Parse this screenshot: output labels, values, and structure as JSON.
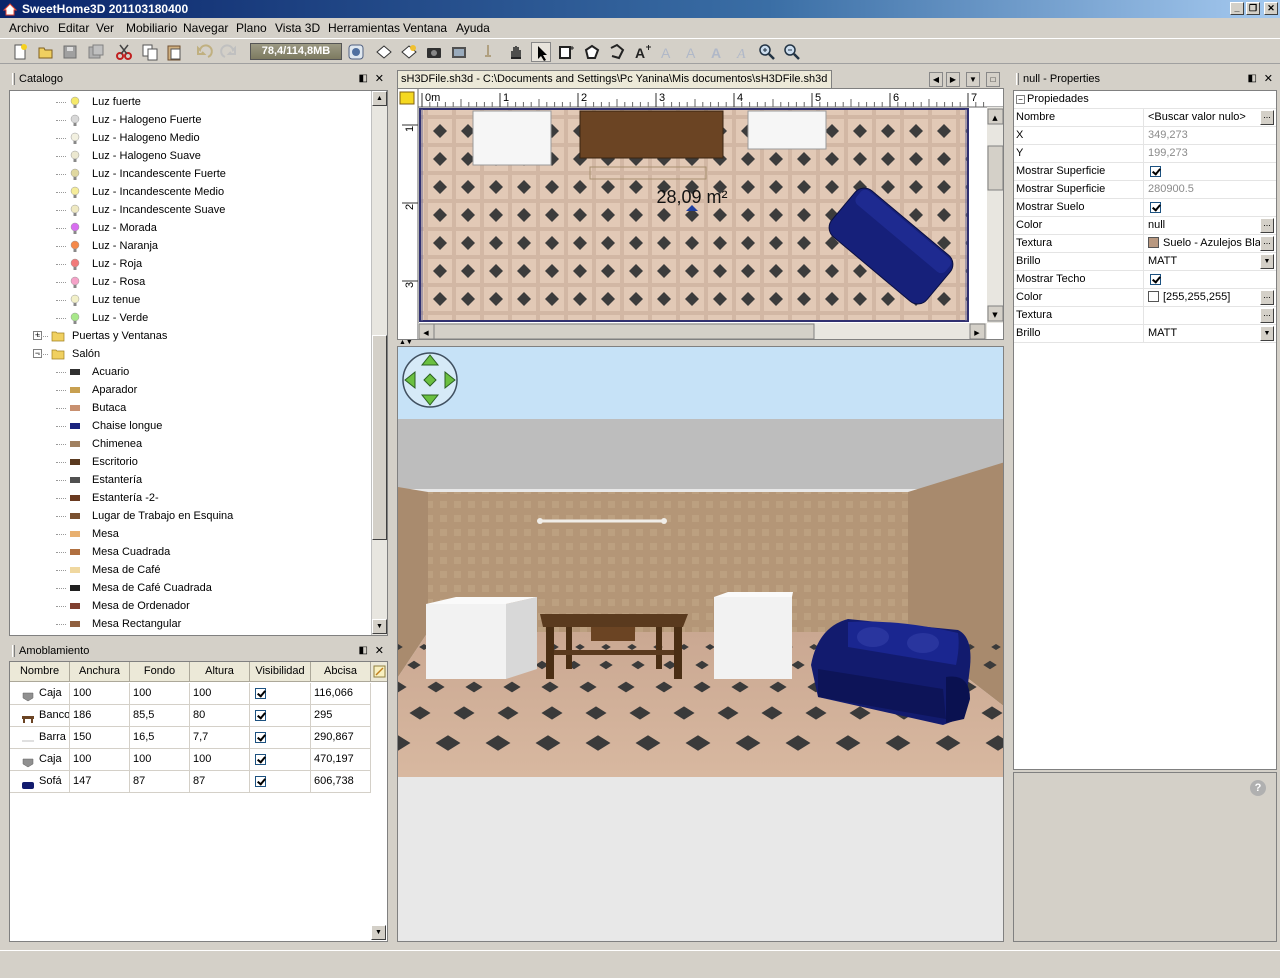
{
  "window": {
    "title": "SweetHome3D 201103180400",
    "minimize_label": "_",
    "maximize_label": "❐",
    "close_label": "✕"
  },
  "menu": [
    "Archivo",
    "Editar",
    "Ver",
    "Mobiliario",
    "Navegar",
    "Plano",
    "Vista 3D",
    "Herramientas",
    "Ventana",
    "Ayuda"
  ],
  "toolbar": {
    "memory": "78,4/114,8MB",
    "icons": [
      "new-icon",
      "open-icon",
      "save-icon",
      "save-as-icon",
      "cut-icon",
      "copy-icon",
      "paste-icon",
      "undo-icon",
      "redo-icon",
      "preferences-icon",
      "add-furniture-icon",
      "import-furniture-icon",
      "photo-icon",
      "video-icon",
      "pan-icon",
      "select-icon",
      "create-walls-icon",
      "create-rooms-icon",
      "create-dimensions-icon",
      "add-text-icon",
      "zoom-in-icon",
      "zoom-out-icon"
    ]
  },
  "catalog": {
    "title": "Catalogo",
    "items": [
      {
        "label": "Luz fuerte",
        "depth": 2,
        "icon": "bulb",
        "color": "#f5e96a"
      },
      {
        "label": "Luz - Halogeno Fuerte",
        "depth": 2,
        "icon": "halogen",
        "color": "#d8d8d8"
      },
      {
        "label": "Luz - Halogeno Medio",
        "depth": 2,
        "icon": "bulb",
        "color": "#f2f0e0"
      },
      {
        "label": "Luz - Halogeno Suave",
        "depth": 2,
        "icon": "bulb",
        "color": "#ece8d0"
      },
      {
        "label": "Luz - Incandescente Fuerte",
        "depth": 2,
        "icon": "halogen",
        "color": "#e0d8a0"
      },
      {
        "label": "Luz - Incandescente Medio",
        "depth": 2,
        "icon": "bulb",
        "color": "#f5ec9a"
      },
      {
        "label": "Luz - Incandescente Suave",
        "depth": 2,
        "icon": "bulb",
        "color": "#efe9c2"
      },
      {
        "label": "Luz - Morada",
        "depth": 2,
        "icon": "bulb",
        "color": "#d86ef0"
      },
      {
        "label": "Luz - Naranja",
        "depth": 2,
        "icon": "bulb",
        "color": "#f5894a"
      },
      {
        "label": "Luz - Roja",
        "depth": 2,
        "icon": "bulb",
        "color": "#f27a7a"
      },
      {
        "label": "Luz - Rosa",
        "depth": 2,
        "icon": "bulb",
        "color": "#f5a2c8"
      },
      {
        "label": "Luz tenue",
        "depth": 2,
        "icon": "bulb",
        "color": "#f2f0c8"
      },
      {
        "label": "Luz - Verde",
        "depth": 2,
        "icon": "bulb",
        "color": "#a8e88a"
      },
      {
        "label": "Puertas y Ventanas",
        "depth": 1,
        "icon": "folder",
        "color": "#f0d060",
        "expander": "+"
      },
      {
        "label": "Salón",
        "depth": 1,
        "icon": "folder-open",
        "color": "#f0d060",
        "expander": "−"
      },
      {
        "label": "Acuario",
        "depth": 2,
        "icon": "aquarium",
        "color": "#303030"
      },
      {
        "label": "Aparador",
        "depth": 2,
        "icon": "sideboard",
        "color": "#c8a050"
      },
      {
        "label": "Butaca",
        "depth": 2,
        "icon": "armchair",
        "color": "#c89070"
      },
      {
        "label": "Chaise longue",
        "depth": 2,
        "icon": "chaise",
        "color": "#1a237e"
      },
      {
        "label": "Chimenea",
        "depth": 2,
        "icon": "fireplace",
        "color": "#a08060"
      },
      {
        "label": "Escritorio",
        "depth": 2,
        "icon": "desk",
        "color": "#5a3a20"
      },
      {
        "label": "Estantería",
        "depth": 2,
        "icon": "shelf",
        "color": "#505050"
      },
      {
        "label": "Estantería -2-",
        "depth": 2,
        "icon": "shelf",
        "color": "#6a3a20"
      },
      {
        "label": "Lugar de Trabajo en Esquina",
        "depth": 2,
        "icon": "workplace",
        "color": "#7a5030"
      },
      {
        "label": "Mesa",
        "depth": 2,
        "icon": "table",
        "color": "#e8b070"
      },
      {
        "label": "Mesa Cuadrada",
        "depth": 2,
        "icon": "table",
        "color": "#b07040"
      },
      {
        "label": "Mesa de Café",
        "depth": 2,
        "icon": "table",
        "color": "#f0d8a0"
      },
      {
        "label": "Mesa de Café Cuadrada",
        "depth": 2,
        "icon": "table",
        "color": "#202020"
      },
      {
        "label": "Mesa de Ordenador",
        "depth": 2,
        "icon": "desk",
        "color": "#804030"
      },
      {
        "label": "Mesa Rectangular",
        "depth": 2,
        "icon": "table",
        "color": "#906040"
      }
    ]
  },
  "furniture": {
    "title": "Amoblamiento",
    "columns": [
      "Nombre",
      "Anchura",
      "Fondo",
      "Altura",
      "Visibilidad",
      "Abcisa"
    ],
    "rows": [
      {
        "name": "Caja",
        "icon": "box-icon",
        "width": "100",
        "depth": "100",
        "height": "100",
        "visible": true,
        "x": "116,066"
      },
      {
        "name": "Banco",
        "icon": "bench-icon",
        "width": "186",
        "depth": "85,5",
        "height": "80",
        "visible": true,
        "x": "295"
      },
      {
        "name": "Barra",
        "icon": "bar-icon",
        "width": "150",
        "depth": "16,5",
        "height": "7,7",
        "visible": true,
        "x": "290,867"
      },
      {
        "name": "Caja",
        "icon": "box-icon",
        "width": "100",
        "depth": "100",
        "height": "100",
        "visible": true,
        "x": "470,197"
      },
      {
        "name": "Sofá",
        "icon": "sofa-icon",
        "width": "147",
        "depth": "87",
        "height": "87",
        "visible": true,
        "x": "606,738"
      }
    ]
  },
  "plan": {
    "tab_title": "sH3DFile.sh3d - C:\\Documents and Settings\\Pc Yanina\\Mis documentos\\sH3DFile.sh3d",
    "ruler_x": [
      "0m",
      "1",
      "2",
      "3",
      "4",
      "5",
      "6",
      "7"
    ],
    "ruler_y": [
      "1",
      "2",
      "3"
    ],
    "room_area": "28,09 m²"
  },
  "properties": {
    "title": "null - Properties",
    "section": "Propiedades",
    "rows": [
      {
        "key": "Nombre",
        "value": "<Buscar valor nulo>",
        "button": true
      },
      {
        "key": "X",
        "value": "349,273",
        "grey": true
      },
      {
        "key": "Y",
        "value": "199,273",
        "grey": true
      },
      {
        "key": "Mostrar Superficie",
        "check": true
      },
      {
        "key": "Mostrar Superficie",
        "value": "280900.5",
        "grey": true
      },
      {
        "key": "Mostrar Suelo",
        "check": true
      },
      {
        "key": "Color",
        "value": "null",
        "button": true
      },
      {
        "key": "Textura",
        "value": "Suelo - Azulejos Blancos",
        "swatch": "#b89880",
        "button": true
      },
      {
        "key": "Brillo",
        "value": "MATT",
        "dropdown": true
      },
      {
        "key": "Mostrar Techo",
        "check": true
      },
      {
        "key": "Color",
        "value": "[255,255,255]",
        "swatch": "#ffffff",
        "button": true
      },
      {
        "key": "Textura",
        "value": "",
        "button": true
      },
      {
        "key": "Brillo",
        "value": "MATT",
        "dropdown": true
      }
    ],
    "help_label": "?"
  },
  "colors": {
    "titlebar": "#0a246a",
    "sofa": "#121b6e",
    "floor": "#c9a88d",
    "sky": "#c6e2f7"
  }
}
